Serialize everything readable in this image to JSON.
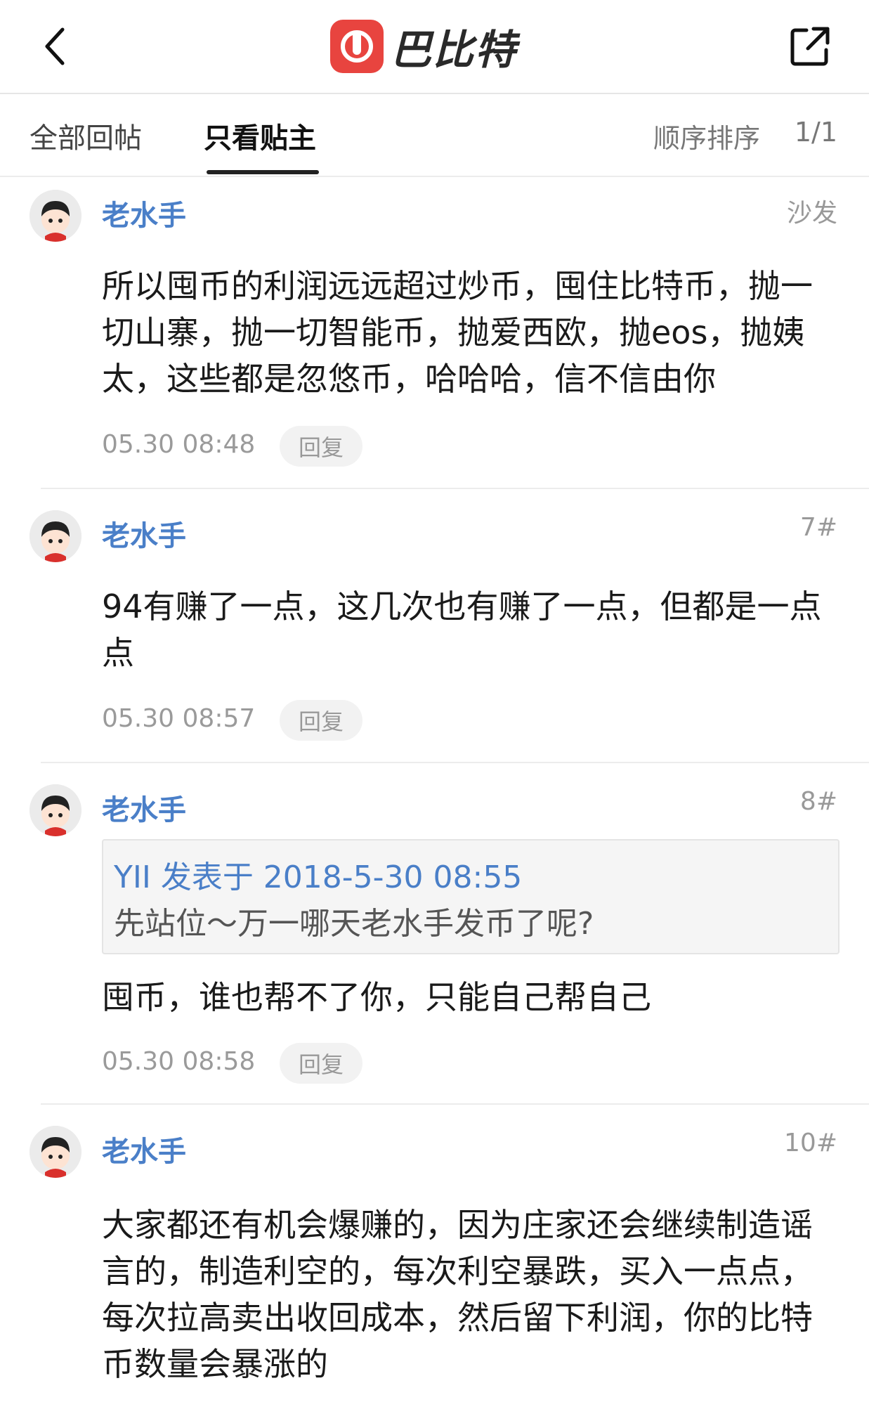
{
  "header": {
    "logo_text": "巴比特",
    "back_icon": "chevron-left-icon",
    "share_icon": "share-external-icon",
    "brand_color": "#e8443f"
  },
  "tabs": {
    "all": "全部回帖",
    "op_only": "只看贴主",
    "sort": "顺序排序",
    "page": "1/1"
  },
  "posts": [
    {
      "user": "老水手",
      "floor": "沙发",
      "content": "所以囤币的利润远远超过炒币，囤住比特币，抛一切山寨，抛一切智能币，抛爱西欧，抛eos，抛姨太，这些都是忽悠币，哈哈哈，信不信由你",
      "time": "05.30 08:48",
      "reply": "回复"
    },
    {
      "user": "老水手",
      "floor": "7#",
      "content": "94有赚了一点，这几次也有赚了一点，但都是一点点",
      "time": "05.30 08:57",
      "reply": "回复"
    },
    {
      "user": "老水手",
      "floor": "8#",
      "quote_head": "YII 发表于 2018-5-30 08:55",
      "quote_body": "先站位～万一哪天老水手发币了呢?",
      "content": "囤币，谁也帮不了你，只能自己帮自己",
      "time": "05.30 08:58",
      "reply": "回复"
    },
    {
      "user": "老水手",
      "floor": "10#",
      "content": "大家都还有机会爆赚的，因为庄家还会继续制造谣言的，制造利空的，每次利空暴跌，买入一点点，每次拉高卖出收回成本，然后留下利润，你的比特币数量会暴涨的"
    }
  ]
}
